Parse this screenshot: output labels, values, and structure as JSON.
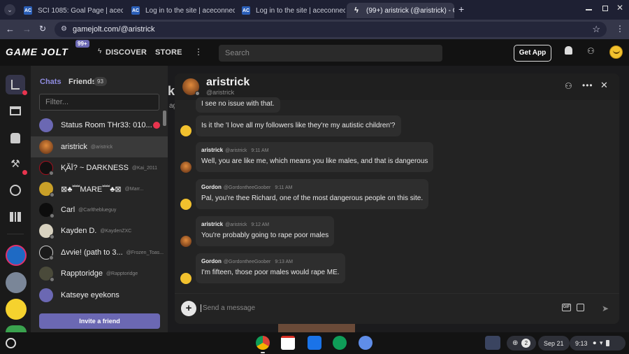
{
  "browser": {
    "tabs": [
      {
        "title": "SCI 1085: Goal Page | aceconn",
        "active": false
      },
      {
        "title": "Log in to the site | aceconnect",
        "active": false
      },
      {
        "title": "Log in to the site | aceconnect",
        "active": false
      },
      {
        "title": "(99+) aristrick (@aristrick) - Ga",
        "active": true
      }
    ],
    "new_tab": "+",
    "url": "gamejolt.com/@aristrick"
  },
  "site": {
    "logo": "GAME JOLT",
    "badge": "99+",
    "nav": [
      "DISCOVER",
      "STORE"
    ],
    "search_placeholder": "Search",
    "get_app": "Get App"
  },
  "chat_sidebar": {
    "tabs": {
      "chats": "Chats",
      "friends": "Friends",
      "friends_count": "93"
    },
    "filter_placeholder": "Filter...",
    "rows": [
      {
        "name": "Status Room THr33: 010...",
        "handle": ""
      },
      {
        "name": "aristrick",
        "handle": "@aristrick"
      },
      {
        "name": "ⱩĂĪ? ~ DARKNESS",
        "handle": "@Kai_2011"
      },
      {
        "name": "⊠♣﹌MARE﹌♣⊠",
        "handle": "@Marr..."
      },
      {
        "name": "Carl",
        "handle": "@Carltheblueguy"
      },
      {
        "name": "Kayden D.",
        "handle": "@KaydenZXC"
      },
      {
        "name": "Δvvie! (path to 3...",
        "handle": "@Frozen_Toas..."
      },
      {
        "name": "Rapptoridge",
        "handle": "@Rapptoridge"
      },
      {
        "name": "Katseye eyekons",
        "handle": ""
      }
    ],
    "invite": "Invite a friend"
  },
  "chat": {
    "title": "aristrick",
    "handle": "@aristrick",
    "partial_top": "I see no issue with that.",
    "messages": [
      {
        "name": "",
        "handle": "",
        "time": "",
        "text": "Is it the 'I love all my followers like they're my autistic children'?"
      },
      {
        "name": "aristrick",
        "handle": "@aristrick",
        "time": "9:11 AM",
        "text": "Well, you are like me, which means you like males, and that is dangerous"
      },
      {
        "name": "Gordon",
        "handle": "@GordontheeGoober",
        "time": "9:11 AM",
        "text": "Pal, you're thee Richard, one of the most dangerous people on this site."
      },
      {
        "name": "aristrick",
        "handle": "@aristrick",
        "time": "9:12 AM",
        "text": "You're probably going to rape poor males"
      },
      {
        "name": "Gordon",
        "handle": "@GordontheeGoober",
        "time": "9:13 AM",
        "text": "I'm fifteen, those poor males would rape ME."
      }
    ],
    "composer_placeholder": "Send a message"
  },
  "background_profile": {
    "partial_title": "k",
    "partial_sub": "ag"
  },
  "shelf": {
    "notifications": "2",
    "date": "Sep 21",
    "time": "9:13"
  },
  "colors": {
    "accent": "#6b68b3",
    "chats_tab": "#8f8ce0",
    "unread": "#e8344e",
    "chrome_bg": "#1e2033"
  }
}
